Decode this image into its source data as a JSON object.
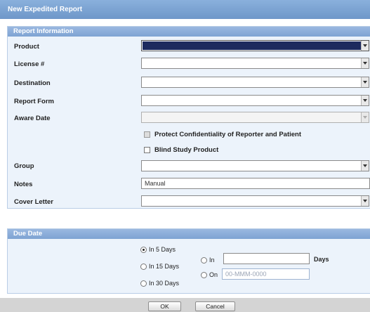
{
  "window": {
    "title": "New Expedited Report"
  },
  "report_info": {
    "header": "Report Information",
    "product": {
      "label": "Product",
      "value": ""
    },
    "license": {
      "label": "License #",
      "value": ""
    },
    "destination": {
      "label": "Destination",
      "value": ""
    },
    "report_form": {
      "label": "Report Form",
      "value": ""
    },
    "aware_date": {
      "label": "Aware Date",
      "value": ""
    },
    "protect_confidentiality": {
      "label": "Protect Confidentiality of Reporter and Patient",
      "checked": false,
      "disabled": true
    },
    "blind_study": {
      "label": "Blind Study Product",
      "checked": false
    },
    "group": {
      "label": "Group",
      "value": ""
    },
    "notes": {
      "label": "Notes",
      "value": "Manual"
    },
    "cover_letter": {
      "label": "Cover Letter",
      "value": ""
    }
  },
  "due_date": {
    "header": "Due Date",
    "options": {
      "in5": {
        "label": "In 5 Days",
        "selected": true
      },
      "in15": {
        "label": "In 15 Days",
        "selected": false
      },
      "in30": {
        "label": "In 30 Days",
        "selected": false
      },
      "in_custom": {
        "label": "In",
        "value": "",
        "suffix": "Days",
        "selected": false
      },
      "on_date": {
        "label": "On",
        "placeholder": "00-MMM-0000",
        "selected": false
      }
    }
  },
  "buttons": {
    "ok": "OK",
    "cancel": "Cancel"
  },
  "colors": {
    "title_bar": "#7aa0cf",
    "panel_bg": "#ecf3fb",
    "product_selected": "#1d2a5e",
    "footer": "#d4d4d4"
  }
}
